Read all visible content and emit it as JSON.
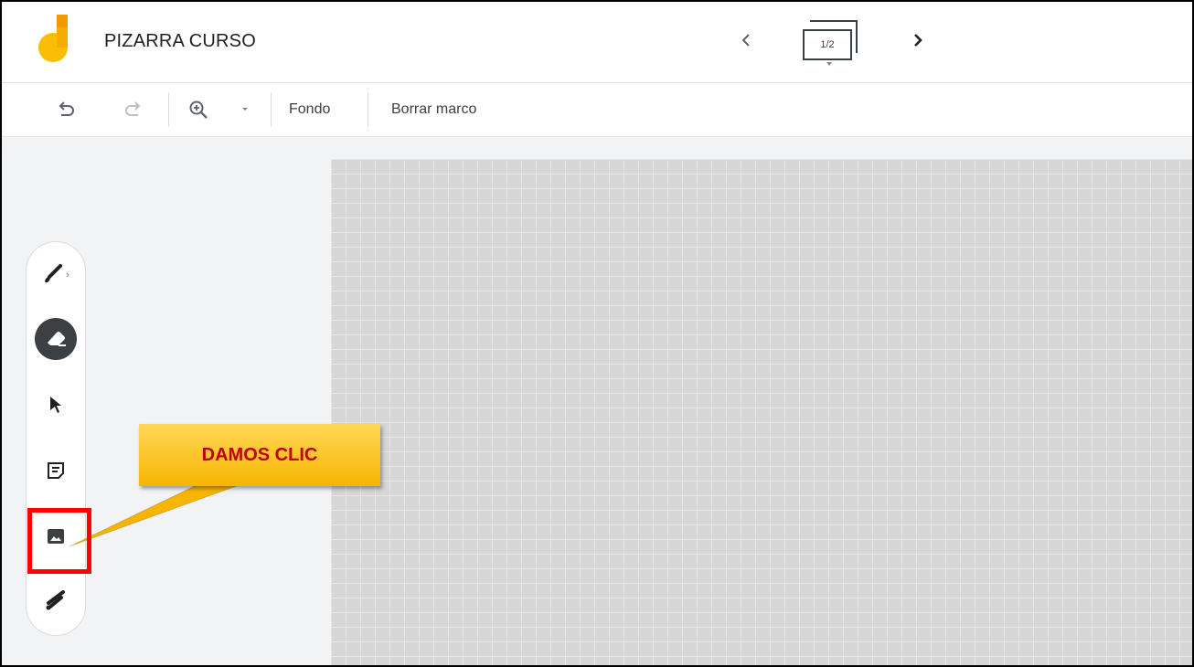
{
  "header": {
    "title": "PIZARRA CURSO",
    "frame_indicator": "1/2"
  },
  "toolbar": {
    "undo_icon": "undo-icon",
    "redo_icon": "redo-icon",
    "zoom_icon": "zoom-in-icon",
    "background_label": "Fondo",
    "clear_frame_label": "Borrar marco"
  },
  "tools": [
    {
      "name": "pen",
      "icon": "brush-icon"
    },
    {
      "name": "eraser",
      "icon": "eraser-icon"
    },
    {
      "name": "select",
      "icon": "cursor-icon"
    },
    {
      "name": "sticky-note",
      "icon": "sticky-note-icon"
    },
    {
      "name": "image",
      "icon": "image-icon"
    },
    {
      "name": "laser",
      "icon": "laser-icon"
    }
  ],
  "annotation": {
    "callout_text": "DAMOS CLIC",
    "callout_color": "#c00000",
    "highlight_color": "#ff0000"
  },
  "colors": {
    "logo_yellow": "#fbbc04",
    "logo_orange": "#f29900",
    "canvas_bg": "#d6d6d6"
  }
}
